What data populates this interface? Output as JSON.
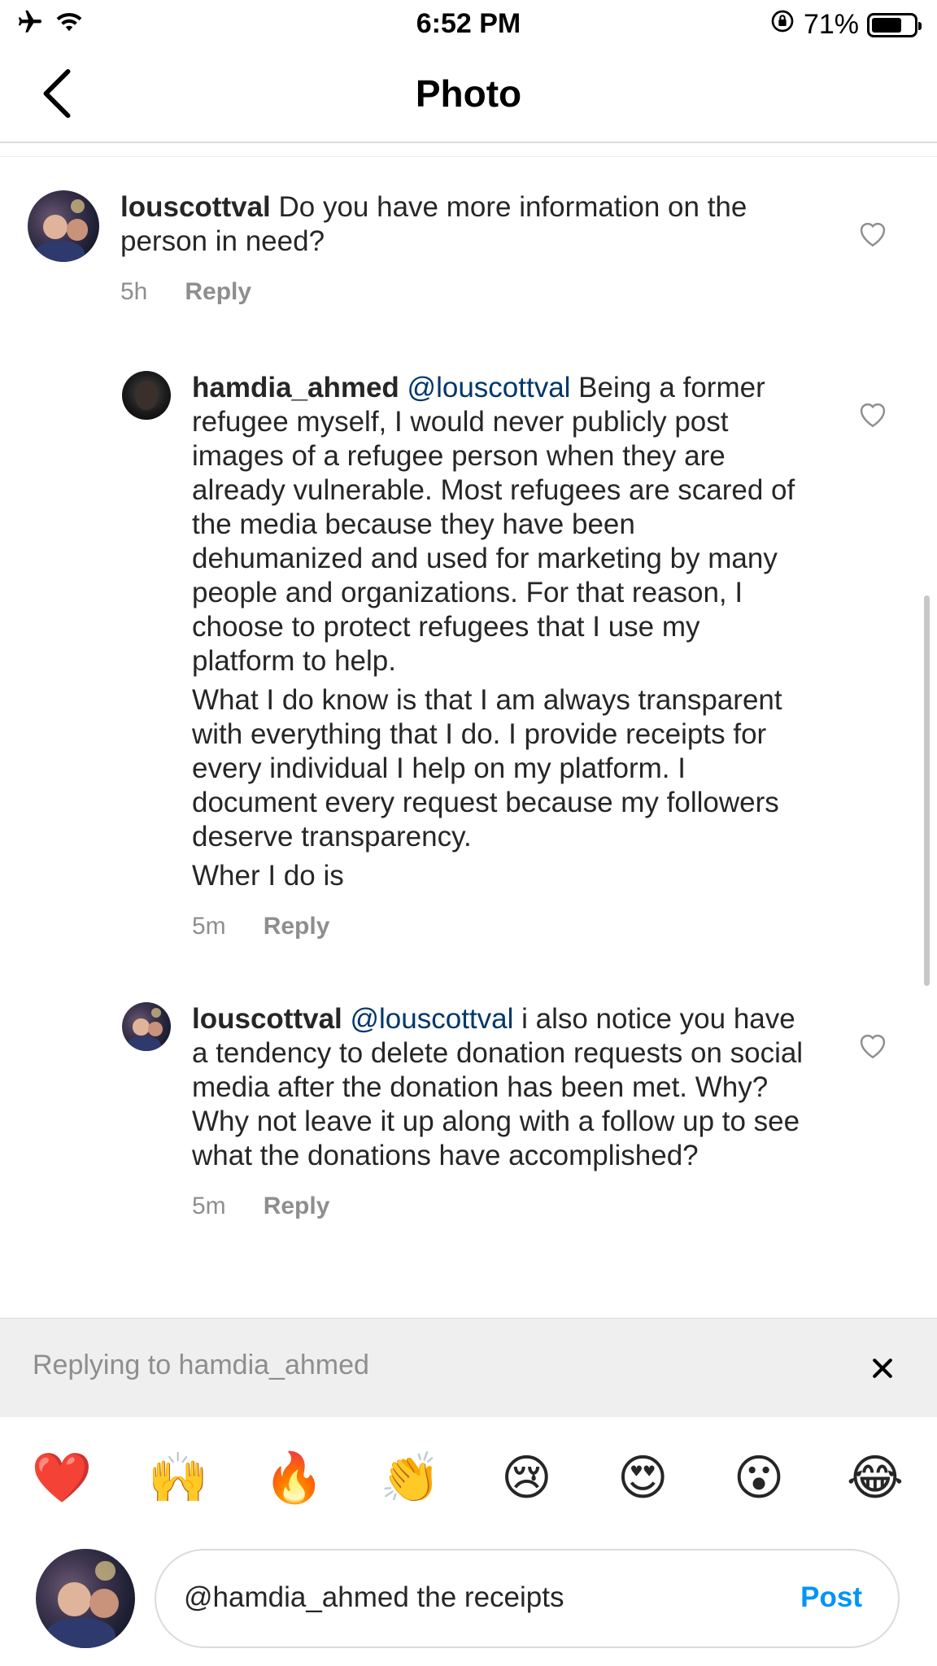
{
  "status_bar": {
    "time": "6:52 PM",
    "battery": "71%",
    "battery_level": 0.71,
    "icons": [
      "airplane-icon",
      "wifi-icon",
      "orientation-lock-icon",
      "battery-icon"
    ]
  },
  "nav": {
    "title": "Photo",
    "back_icon": "chevron-left-icon"
  },
  "comments": [
    {
      "username": "louscottval",
      "mention": "",
      "text": " Do you have more information on the person in need?",
      "time": "5h",
      "reply_label": "Reply"
    },
    {
      "username": "hamdia_ahmed",
      "mention": "@louscottval",
      "text": "  Being a former refugee myself, I would never publicly post images of a refugee person when they are already vulnerable. Most refugees are scared of the media because they have been dehumanized and used for marketing by many people and organizations. For that reason, I choose to protect refugees that I use my platform to help.",
      "text2": "What I do know is that I am always transparent with everything that I do. I provide receipts for every individual I help on my platform. I document every request because my followers deserve transparency.",
      "text3": "Wher I do is",
      "time": "5m",
      "reply_label": "Reply"
    },
    {
      "username": "louscottval",
      "mention": "@louscottval",
      "text": " i also notice you have a tendency to delete donation requests on social media after the donation has been met. Why? Why not leave it up along with a follow up to see what the donations have accomplished?",
      "time": "5m",
      "reply_label": "Reply"
    }
  ],
  "replying_bar": {
    "text": "Replying to hamdia_ahmed"
  },
  "emoji_bar": [
    "❤️",
    "🙌",
    "🔥",
    "👏",
    "😢",
    "😍",
    "😮",
    "😂"
  ],
  "composer": {
    "value": "@hamdia_ahmed the receipts",
    "post_label": "Post"
  },
  "colors": {
    "mention": "#00376b",
    "post": "#0095f6",
    "muted": "#8e8e8e"
  }
}
